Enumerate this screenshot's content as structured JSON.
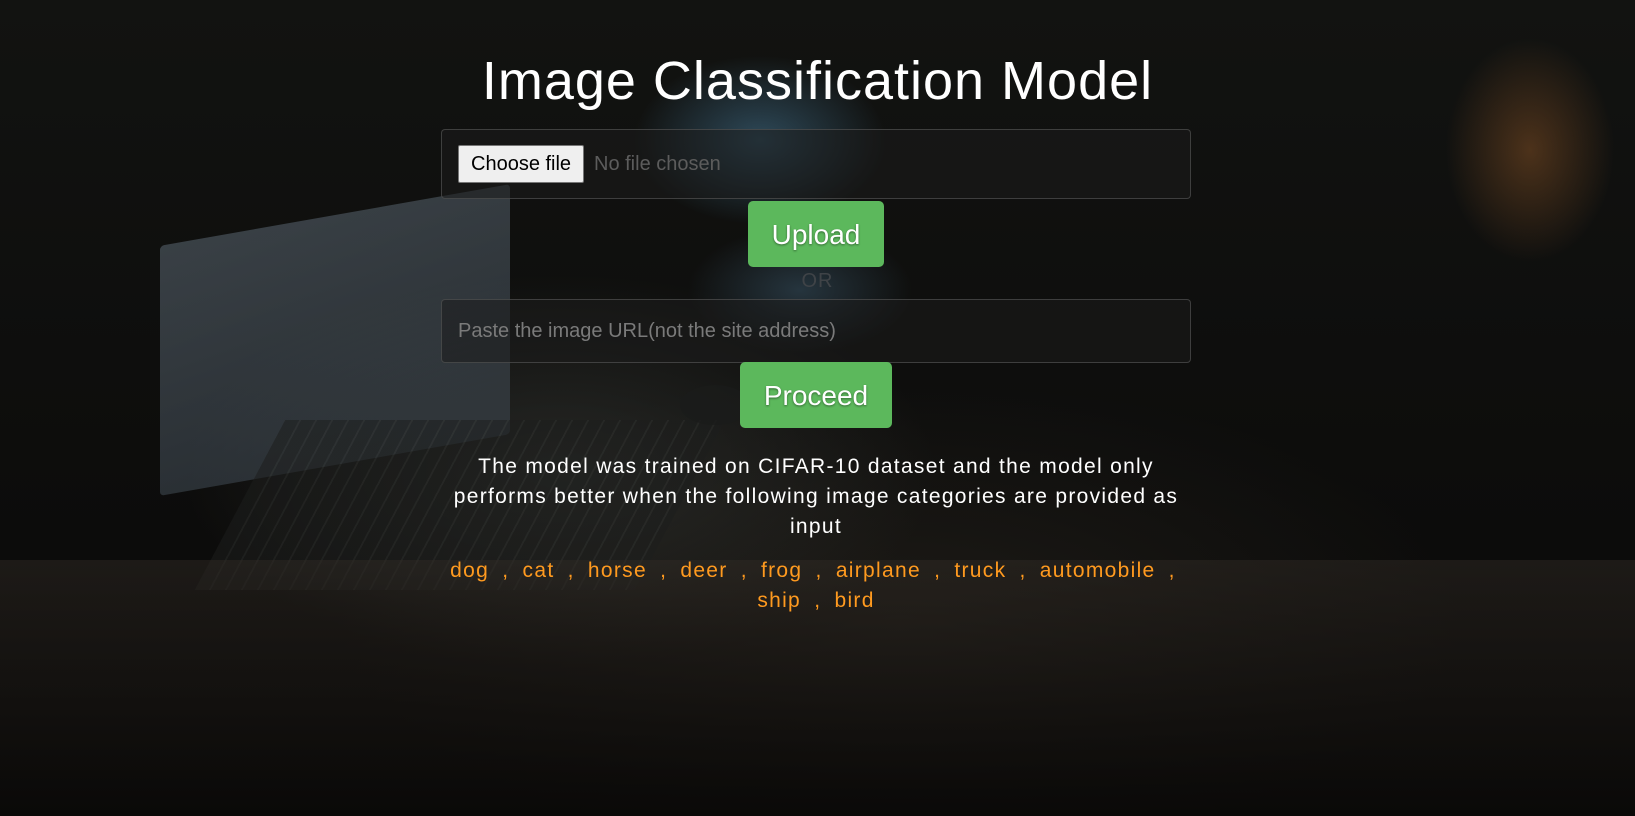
{
  "page": {
    "title": "Image Classification Model"
  },
  "upload_form": {
    "choose_file_label": "Choose file",
    "file_status": "No file chosen",
    "upload_label": "Upload"
  },
  "divider": {
    "or_text": "OR"
  },
  "url_form": {
    "placeholder": "Paste the image URL(not the site address)",
    "value": "",
    "proceed_label": "Proceed"
  },
  "info": {
    "description": "The model was trained on CIFAR-10 dataset and the model only performs better when the following image categories are provided as input",
    "categories": [
      "dog",
      "cat",
      "horse",
      "deer",
      "frog",
      "airplane",
      "truck",
      "automobile",
      "ship",
      "bird"
    ],
    "separator": ","
  },
  "colors": {
    "button_green": "#5cb85c",
    "category_orange": "#ff9a1f",
    "title_text": "#ffffff"
  }
}
